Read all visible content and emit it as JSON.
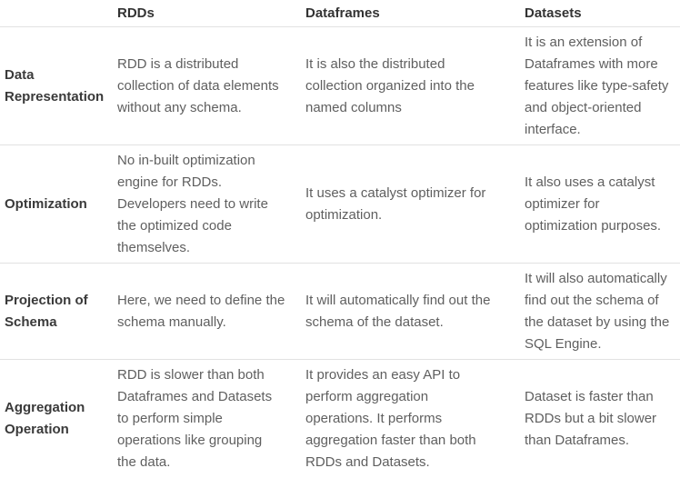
{
  "headers": [
    "",
    "RDDs",
    "Dataframes",
    "Datasets"
  ],
  "rows": [
    {
      "label": "Data\nRepresentation",
      "rdds": "RDD is a distributed\ncollection of data elements\nwithout any schema.",
      "dataframes": "It is also the distributed\ncollection organized into the\nnamed columns",
      "datasets": "It is an extension of\nDataframes with more\nfeatures like type-safety\nand object-oriented\ninterface."
    },
    {
      "label": "Optimization",
      "rdds": "No in-built optimization\nengine for RDDs.\nDevelopers need to write\nthe optimized code\nthemselves.",
      "dataframes": "It uses a catalyst optimizer for\noptimization.",
      "datasets": "It also uses a catalyst\noptimizer for\noptimization purposes."
    },
    {
      "label": "Projection of\nSchema",
      "rdds": "Here, we need to define the\nschema manually.",
      "dataframes": "It will automatically find out the\nschema of the dataset.",
      "datasets": "It will also automatically\nfind out the schema of\nthe dataset by using the\nSQL Engine."
    },
    {
      "label": "Aggregation\nOperation",
      "rdds": "RDD is slower than both\nDataframes and Datasets\nto perform simple\noperations like grouping\nthe data.",
      "dataframes": "It provides an easy API to\nperform aggregation\noperations. It performs\naggregation faster than both\nRDDs and Datasets.",
      "datasets": "Dataset is faster than\nRDDs but a bit slower\nthan Dataframes."
    }
  ]
}
